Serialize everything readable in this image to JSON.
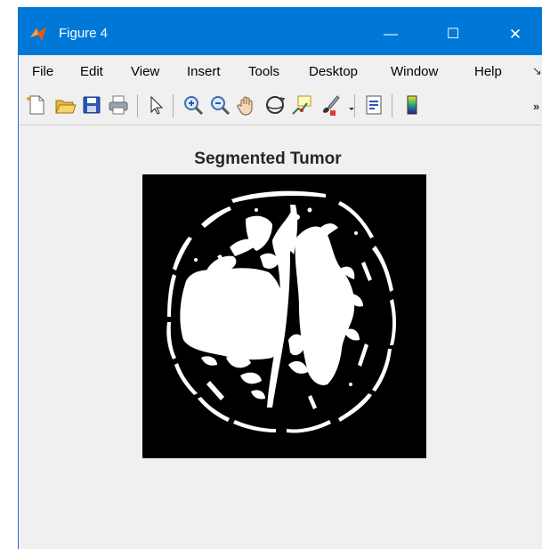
{
  "window": {
    "title": "Figure 4",
    "controls": {
      "minimize": "—",
      "maximize": "☐",
      "close": "✕"
    }
  },
  "menu": {
    "items": [
      "File",
      "Edit",
      "View",
      "Insert",
      "Tools",
      "Desktop",
      "Window",
      "Help"
    ],
    "overflow": "↘"
  },
  "toolbar": {
    "tools": [
      "new-figure-icon",
      "open-file-icon",
      "save-icon",
      "print-icon",
      "pointer-icon",
      "zoom-in-icon",
      "zoom-out-icon",
      "pan-hand-icon",
      "rotate-3d-icon",
      "data-cursor-icon",
      "brush-icon",
      "link-plot-icon",
      "colorbar-icon"
    ],
    "overflow": "»"
  },
  "plot": {
    "title": "Segmented Tumor",
    "image": "binary-segmentation-mask",
    "background_color": "#000000",
    "foreground_color": "#ffffff"
  },
  "colors": {
    "titlebar": "#0078d7",
    "window_bg": "#f0f0f0"
  }
}
